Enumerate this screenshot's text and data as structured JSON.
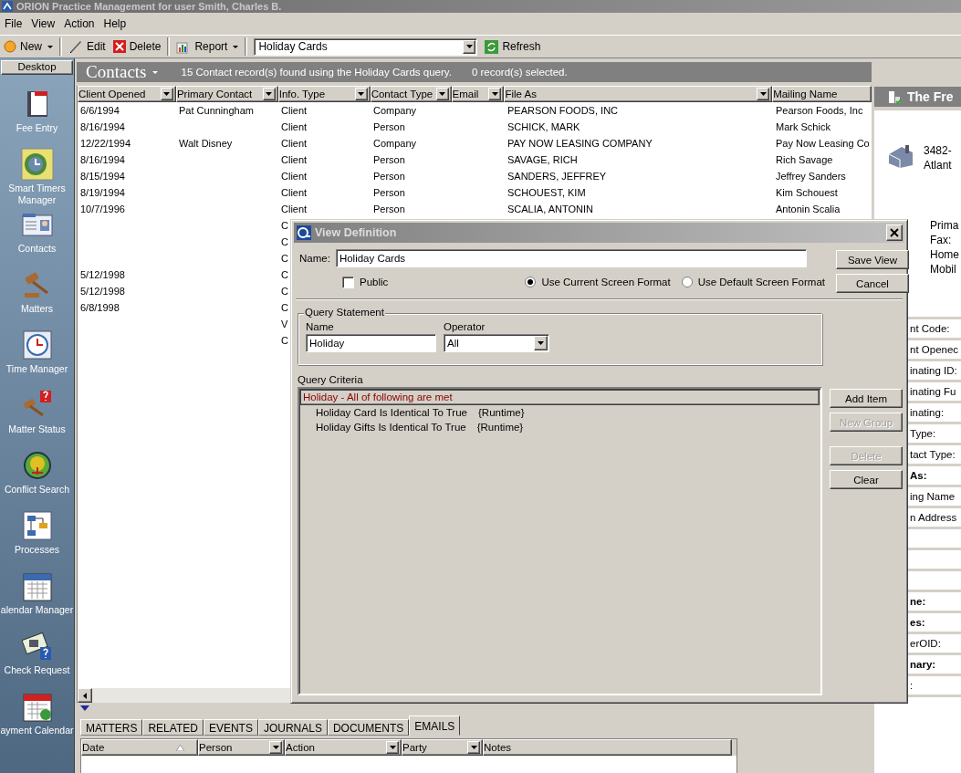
{
  "window": {
    "title": "ORION Practice Management for user Smith, Charles B."
  },
  "menu": [
    "File",
    "View",
    "Action",
    "Help"
  ],
  "toolbar": [
    {
      "kind": "button",
      "label": "New",
      "dropdown": true
    },
    {
      "kind": "separator"
    },
    {
      "kind": "button",
      "label": "Edit",
      "dropdown": false
    },
    {
      "kind": "button",
      "label": "Delete",
      "dropdown": false
    },
    {
      "kind": "separator"
    },
    {
      "kind": "button",
      "label": "Report",
      "dropdown": true
    },
    {
      "kind": "separator"
    },
    {
      "kind": "combo",
      "value": "Holiday Cards"
    },
    {
      "kind": "button",
      "label": "Refresh",
      "dropdown": false
    }
  ],
  "sidebar": {
    "header": "Desktop",
    "items": [
      "Fee Entry",
      "Smart Timers Manager",
      "Contacts",
      "Matters",
      "Time Manager",
      "Matter Status",
      "Conflict Search",
      "Processes",
      "alendar Manager",
      "Check Request",
      "ayment Calendar"
    ]
  },
  "contacts": {
    "title": "Contacts",
    "summary": "15 Contact record(s) found using the Holiday Cards query.",
    "selection": "0 record(s) selected.",
    "columns": [
      {
        "label": "Client Opened",
        "kind": "filter"
      },
      {
        "label": "Primary Contact",
        "kind": "filter"
      },
      {
        "label": "Info. Type",
        "kind": "filter"
      },
      {
        "label": "Contact Type",
        "kind": "filter"
      },
      {
        "label": "Email",
        "kind": "filter"
      },
      {
        "label": "File As",
        "kind": "filter"
      },
      {
        "label": "Mailing Name",
        "kind": "plain"
      }
    ],
    "rows": [
      [
        "6/6/1994",
        "Pat Cunningham",
        "Client",
        "Company",
        null,
        "PEARSON FOODS, INC",
        "Pearson Foods, Inc"
      ],
      [
        "8/16/1994",
        null,
        "Client",
        "Person",
        null,
        "SCHICK, MARK",
        "Mark Schick"
      ],
      [
        "12/22/1994",
        "Walt Disney",
        "Client",
        "Company",
        null,
        "PAY NOW LEASING COMPANY",
        "Pay Now Leasing Co"
      ],
      [
        "8/16/1994",
        null,
        "Client",
        "Person",
        null,
        "SAVAGE, RICH",
        "Rich Savage"
      ],
      [
        "8/15/1994",
        null,
        "Client",
        "Person",
        null,
        "SANDERS, JEFFREY",
        "Jeffrey Sanders"
      ],
      [
        "8/19/1994",
        null,
        "Client",
        "Person",
        null,
        "SCHOUEST, KIM",
        "Kim Schouest"
      ],
      [
        "10/7/1996",
        null,
        "Client",
        "Person",
        null,
        "SCALIA, ANTONIN",
        "Antonin Scalia"
      ],
      [
        null,
        null,
        "C"
      ],
      [
        null,
        null,
        "C"
      ],
      [
        null,
        null,
        "C"
      ],
      [
        "5/12/1998",
        null,
        "C"
      ],
      [
        "5/12/1998",
        null,
        "C"
      ],
      [
        "6/8/1998",
        null,
        "C"
      ],
      [
        null,
        null,
        "V"
      ],
      [
        null,
        null,
        "C"
      ]
    ]
  },
  "tabs": [
    {
      "label": "MATTERS",
      "selected": false
    },
    {
      "label": "RELATED",
      "selected": false
    },
    {
      "label": "EVENTS",
      "selected": false
    },
    {
      "label": "JOURNALS",
      "selected": false
    },
    {
      "label": "DOCUMENTS",
      "selected": false
    },
    {
      "label": "EMAILS",
      "selected": true
    }
  ],
  "emails": {
    "columns": [
      {
        "label": "Date",
        "kind": "sorted"
      },
      {
        "label": "Person",
        "kind": "filter"
      },
      {
        "label": "Action",
        "kind": "filter"
      },
      {
        "label": "Party",
        "kind": "filter"
      },
      {
        "label": "Notes",
        "kind": "plain"
      }
    ]
  },
  "detail": {
    "title": "The Fre",
    "address": [
      "3482-",
      "Atlant"
    ],
    "phones": [
      "Prima",
      "Fax:",
      "Home",
      "Mobil"
    ],
    "fields": [
      {
        "kind": "label",
        "text": "nt Code:",
        "bold": false
      },
      {
        "kind": "label",
        "text": "nt Openec",
        "bold": false
      },
      {
        "kind": "label",
        "text": "inating ID:",
        "bold": false
      },
      {
        "kind": "label",
        "text": "inating Fu",
        "bold": false
      },
      {
        "kind": "label",
        "text": "inating:",
        "bold": false
      },
      {
        "kind": "label",
        "text": "Type:",
        "bold": false
      },
      {
        "kind": "label",
        "text": "tact Type:",
        "bold": false
      },
      {
        "kind": "label",
        "text": "As:",
        "bold": true
      },
      {
        "kind": "label",
        "text": "ing Name",
        "bold": false
      },
      {
        "kind": "label",
        "text": "n Address",
        "bold": false
      },
      {
        "kind": "blank"
      },
      {
        "kind": "blank"
      },
      {
        "kind": "blank"
      },
      {
        "kind": "label",
        "text": "ne:",
        "bold": true
      },
      {
        "kind": "label",
        "text": "es:",
        "bold": true
      },
      {
        "kind": "label",
        "text": "erOID:",
        "bold": false
      },
      {
        "kind": "label",
        "text": "nary:",
        "bold": true
      },
      {
        "kind": "label",
        "text": ":",
        "bold": false
      }
    ]
  },
  "dialog": {
    "title": "View Definition",
    "name_label": "Name:",
    "name_value": "Holiday Cards",
    "public": {
      "label": "Public",
      "checked": false
    },
    "formats": [
      {
        "label": "Use Current Screen Format",
        "selected": true
      },
      {
        "label": "Use Default Screen Format",
        "selected": false
      }
    ],
    "side_buttons": [
      {
        "label": "Save View",
        "disabled": false
      },
      {
        "label": "Cancel",
        "disabled": false
      }
    ],
    "statement": {
      "title": "Query Statement",
      "name_label": "Name",
      "name_value": "Holiday",
      "operator_label": "Operator",
      "operator_value": "All"
    },
    "criteria": {
      "label": "Query Criteria",
      "tree": [
        {
          "text": "Holiday - All of following are met",
          "selected": true,
          "children": [
            {
              "text": "Holiday Card Is Identical To True",
              "value": "{Runtime}",
              "selected": false
            },
            {
              "text": "Holiday Gifts Is Identical To True",
              "value": "{Runtime}",
              "selected": false
            }
          ]
        }
      ]
    },
    "criteria_buttons": [
      {
        "label": "Add Item",
        "disabled": false
      },
      {
        "label": "New Group",
        "disabled": true
      },
      {
        "label": "Delete",
        "disabled": true
      },
      {
        "label": "Clear",
        "disabled": false
      }
    ]
  }
}
